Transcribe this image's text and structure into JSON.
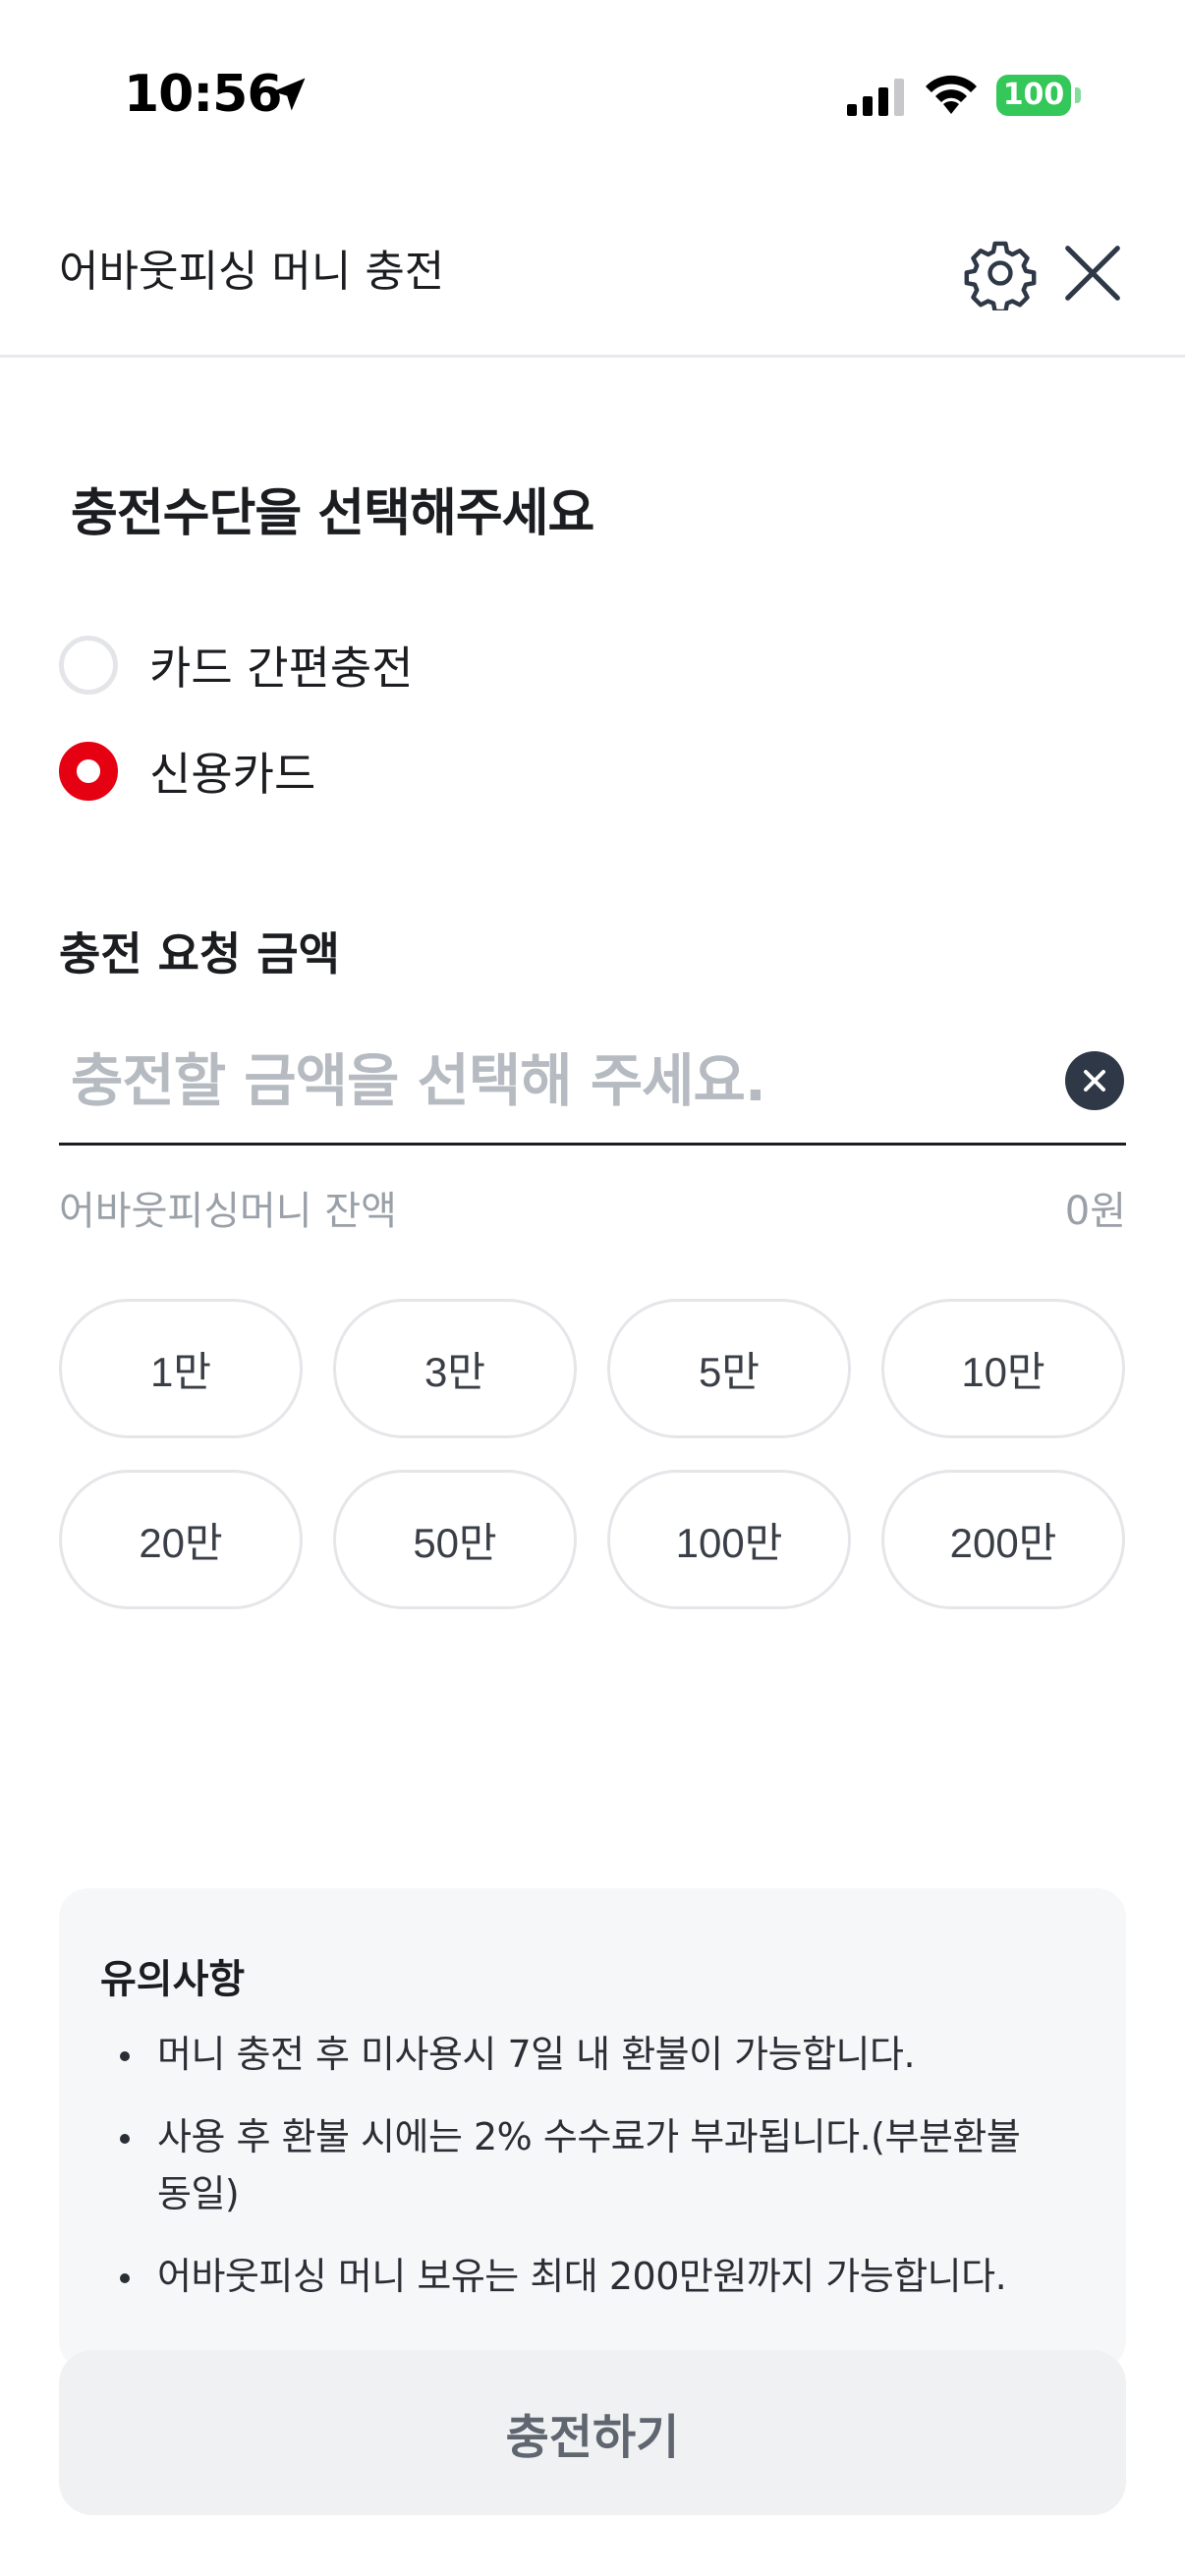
{
  "status_bar": {
    "time": "10:56",
    "battery": "100"
  },
  "header": {
    "title": "어바웃피싱 머니 충전"
  },
  "payment": {
    "title": "충전수단을 선택해주세요",
    "options": [
      {
        "label": "카드 간편충전",
        "selected": false
      },
      {
        "label": "신용카드",
        "selected": true
      }
    ]
  },
  "amount": {
    "title": "충전 요청 금액",
    "placeholder": "충전할 금액을 선택해 주세요.",
    "value": "",
    "balance_label": "어바웃피싱머니 잔액",
    "balance_value": "0원",
    "chips": [
      "1만",
      "3만",
      "5만",
      "10만",
      "20만",
      "50만",
      "100만",
      "200만"
    ]
  },
  "notice": {
    "title": "유의사항",
    "items": [
      "머니 충전 후 미사용시 7일 내 환불이 가능합니다.",
      "사용 후 환불 시에는 2% 수수료가 부과됩니다.(부분환불 동일)",
      "어바웃피싱 머니 보유는 최대 200만원까지 가능합니다."
    ]
  },
  "submit": {
    "label": "충전하기"
  },
  "colors": {
    "accent": "#e50012",
    "battery": "#34c759",
    "clear_button": "#2f3846"
  }
}
